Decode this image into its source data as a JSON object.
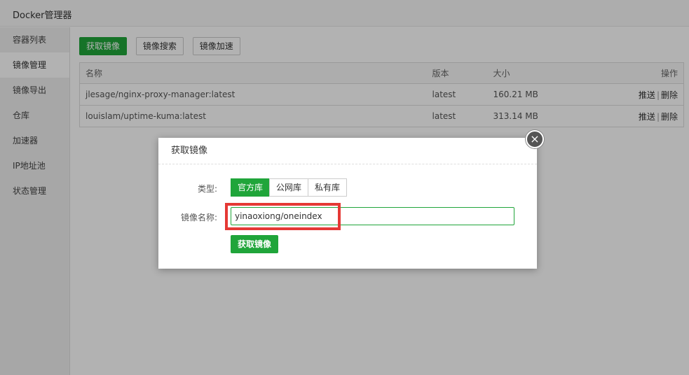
{
  "window": {
    "title": "Docker管理器"
  },
  "sidebar": {
    "items": [
      {
        "label": "容器列表"
      },
      {
        "label": "镜像管理"
      },
      {
        "label": "镜像导出"
      },
      {
        "label": "仓库"
      },
      {
        "label": "加速器"
      },
      {
        "label": "IP地址池"
      },
      {
        "label": "状态管理"
      }
    ]
  },
  "toolbar": {
    "pull_label": "获取镜像",
    "search_label": "镜像搜索",
    "accelerate_label": "镜像加速"
  },
  "table": {
    "headers": {
      "name": "名称",
      "version": "版本",
      "size": "大小",
      "ops": "操作"
    },
    "rows": [
      {
        "name": "jlesage/nginx-proxy-manager:latest",
        "version": "latest",
        "size": "160.21 MB",
        "push": "推送",
        "delete": "删除"
      },
      {
        "name": "louislam/uptime-kuma:latest",
        "version": "latest",
        "size": "313.14 MB",
        "push": "推送",
        "delete": "删除"
      }
    ],
    "op_separator": "|"
  },
  "dialog": {
    "title": "获取镜像",
    "close_glyph": "×",
    "type_label": "类型:",
    "type_options": [
      "官方库",
      "公网库",
      "私有库"
    ],
    "type_selected": "官方库",
    "name_label": "镜像名称:",
    "name_value": "yinaoxiong/oneindex",
    "submit_label": "获取镜像"
  },
  "colors": {
    "accent": "#20a53a",
    "highlight": "#e53935"
  }
}
